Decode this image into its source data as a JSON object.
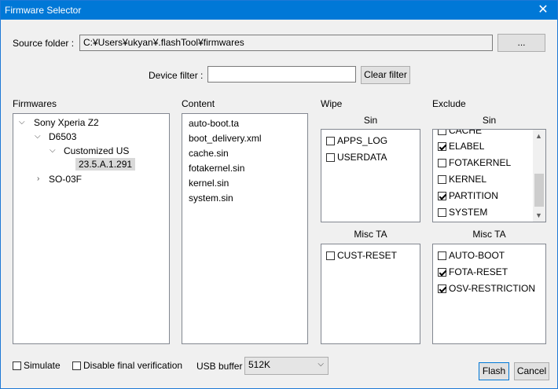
{
  "window": {
    "title": "Firmware Selector"
  },
  "source": {
    "label": "Source folder :",
    "value": "C:¥Users¥ukyan¥.flashTool¥firmwares",
    "browse_label": "..."
  },
  "filter": {
    "label": "Device filter :",
    "value": "",
    "clear_label": "Clear filter"
  },
  "firmwares": {
    "heading": "Firmwares",
    "tree": {
      "root": "Sony Xperia Z2",
      "model1": "D6503",
      "variant": "Customized US",
      "version": "23.5.A.1.291",
      "model2": "SO-03F"
    }
  },
  "content": {
    "heading": "Content",
    "items": [
      "auto-boot.ta",
      "boot_delivery.xml",
      "cache.sin",
      "fotakernel.sin",
      "kernel.sin",
      "system.sin"
    ]
  },
  "wipe": {
    "heading": "Wipe",
    "sin_heading": "Sin",
    "sin_items": [
      {
        "label": "APPS_LOG",
        "checked": false
      },
      {
        "label": "USERDATA",
        "checked": false
      }
    ],
    "ta_heading": "Misc TA",
    "ta_items": [
      {
        "label": "CUST-RESET",
        "checked": false
      }
    ]
  },
  "exclude": {
    "heading": "Exclude",
    "sin_heading": "Sin",
    "sin_items": [
      {
        "label": "CACHE",
        "checked": false
      },
      {
        "label": "ELABEL",
        "checked": true
      },
      {
        "label": "FOTAKERNEL",
        "checked": false
      },
      {
        "label": "KERNEL",
        "checked": false
      },
      {
        "label": "PARTITION",
        "checked": true
      },
      {
        "label": "SYSTEM",
        "checked": false
      }
    ],
    "ta_heading": "Misc TA",
    "ta_items": [
      {
        "label": "AUTO-BOOT",
        "checked": false
      },
      {
        "label": "FOTA-RESET",
        "checked": true
      },
      {
        "label": "OSV-RESTRICTION",
        "checked": true
      }
    ]
  },
  "options": {
    "simulate_label": "Simulate",
    "simulate_checked": false,
    "disable_verification_label": "Disable final verification",
    "disable_verification_checked": false,
    "usb_buffer_label": "USB buffer",
    "usb_buffer_value": "512K"
  },
  "actions": {
    "flash_label": "Flash",
    "cancel_label": "Cancel"
  }
}
